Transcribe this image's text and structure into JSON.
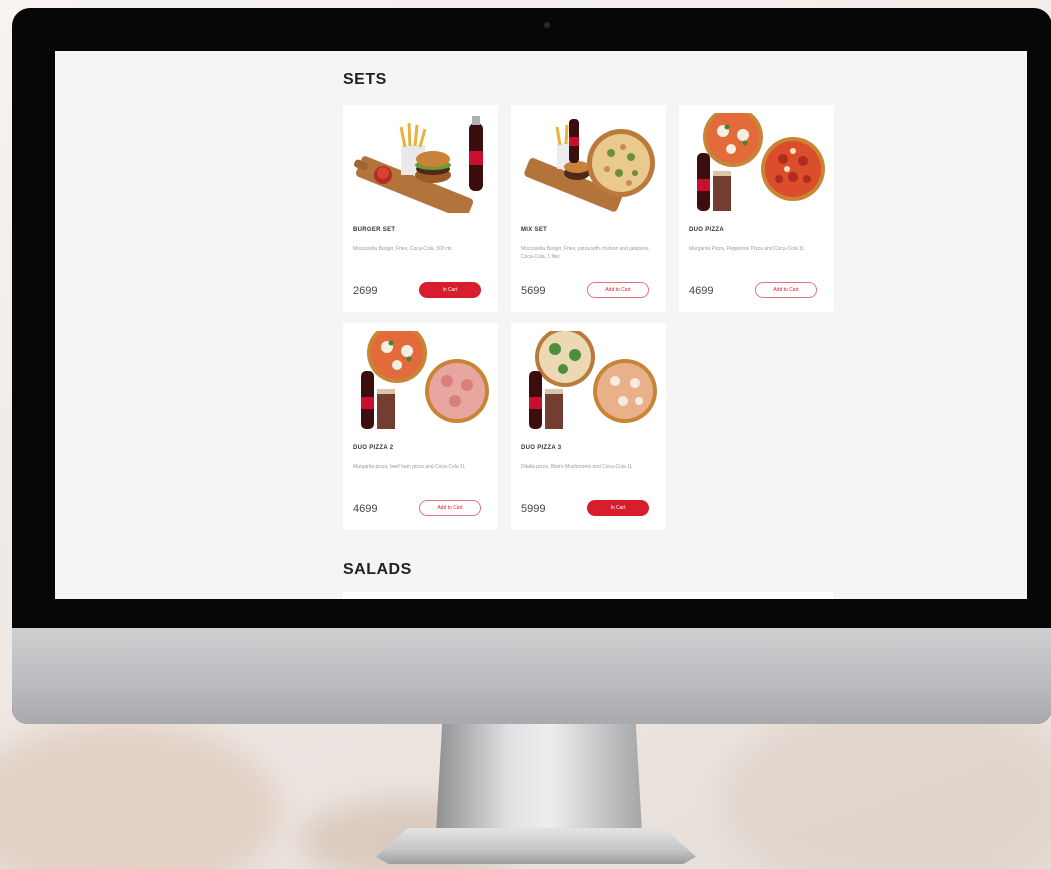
{
  "menu": {
    "sets_title": "SETS",
    "salads_title": "SALADS",
    "sets": [
      {
        "name": "BURGER SET",
        "description": "Mozzarella Burger, Fries, Coca-Cola, 500 ml.",
        "price": "2699",
        "button": "In Cart",
        "in_cart": true,
        "image": "burger-set"
      },
      {
        "name": "MIX SET",
        "description": "Mozzarella Burger, Fries, pizza with chicken and jalapeno, Coca-Cola, 1 liter.",
        "price": "5699",
        "button": "Add to Cart",
        "in_cart": false,
        "image": "mix-set"
      },
      {
        "name": "DUO PIZZA",
        "description": "Margarita Pizza, Pepperoni Pizza and Coca-Cola 1L",
        "price": "4699",
        "button": "Add to Cart",
        "in_cart": false,
        "image": "duo-pizza"
      },
      {
        "name": "DUO PIZZA 2",
        "description": "Margarita pizza, beef ham pizza and Coca-Cola 1L",
        "price": "4699",
        "button": "Add to Cart",
        "in_cart": false,
        "image": "duo-pizza-2"
      },
      {
        "name": "DUO PIZZA 3",
        "description": "Ditalia pizza, Bistro Mushrooms and Coca-Cola 1L",
        "price": "5999",
        "button": "In Cart",
        "in_cart": true,
        "image": "duo-pizza-3"
      }
    ]
  },
  "colors": {
    "accent": "#d81d2c",
    "screen_bg": "#f5f5f5",
    "card_bg": "#ffffff"
  }
}
